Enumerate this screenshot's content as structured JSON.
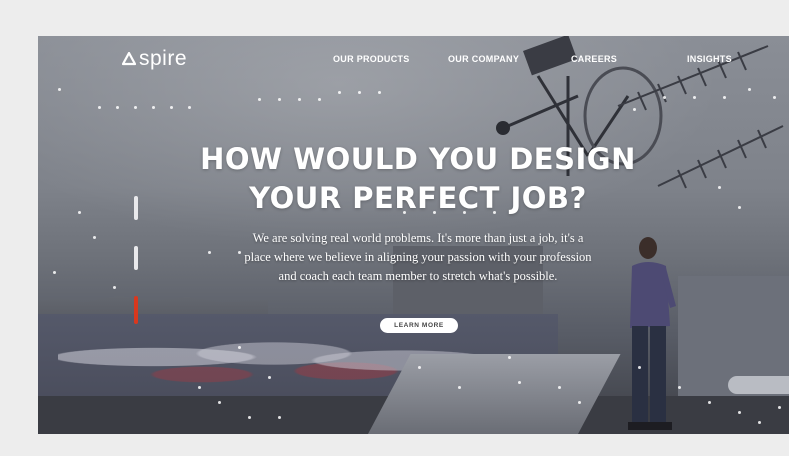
{
  "brand": {
    "name": "spire",
    "logo_icon": "spire-triangle-logo"
  },
  "nav": {
    "items": [
      {
        "label": "OUR PRODUCTS"
      },
      {
        "label": "OUR COMPANY"
      },
      {
        "label": "CAREERS"
      },
      {
        "label": "INSIGHTS"
      }
    ]
  },
  "hero": {
    "headline_line1": "HOW WOULD YOU DESIGN",
    "headline_line2": "YOUR PERFECT JOB?",
    "subtext_line1": "We are solving real world problems. It's more than just a job, it's a",
    "subtext_line2": "place where we believe in aligning your passion with your profession",
    "subtext_line3": "and coach each team member to stretch what's possible.",
    "cta_label": "LEARN MORE"
  },
  "slider": {
    "slide_count": 3,
    "active_slide": 3,
    "inactive_color": "#e9e9ec",
    "active_color": "#d9381e"
  },
  "colors": {
    "page_background": "#ededed",
    "text": "#ffffff",
    "cta_background": "#ffffff"
  }
}
